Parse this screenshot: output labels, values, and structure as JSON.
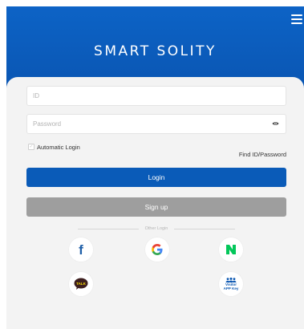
{
  "header": {
    "brand": "SMART SOLITY",
    "background_color": "#0b5cbd",
    "menu_icon": "hamburger-menu-icon"
  },
  "login_form": {
    "id_placeholder": "ID",
    "id_value": "",
    "password_placeholder": "Password",
    "password_value": "",
    "password_toggle_icon": "eye-icon",
    "auto_login_label": "Automatic Login",
    "auto_login_checked": false,
    "find_link": "Find ID/Password",
    "login_button": "Login",
    "signup_button": "Sign up"
  },
  "other_login": {
    "label": "Other Login",
    "providers": [
      {
        "name": "facebook-icon",
        "glyph": "f",
        "color": "#1f5fa8"
      },
      {
        "name": "google-icon",
        "glyph": "G",
        "color": "#e94235"
      },
      {
        "name": "naver-icon",
        "glyph": "N",
        "color": "#03c75a"
      },
      {
        "name": "kakaotalk-icon",
        "glyph": "TALK",
        "color": "#3c1e1e"
      },
      {
        "name": "visitor-app-key-icon",
        "glyph": "Visitor APP Key",
        "color": "#0b57b1"
      }
    ],
    "visitor_line1": "Visitor",
    "visitor_line2": "APP Key"
  },
  "colors": {
    "accent": "#0a5bb8",
    "signup_gray": "#9e9e9e",
    "card_bg": "#f3f3f3"
  }
}
